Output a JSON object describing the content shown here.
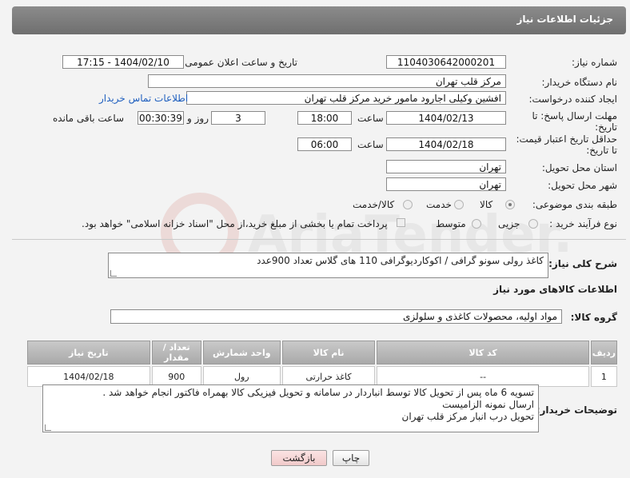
{
  "header": {
    "title": "جزئیات اطلاعات نیاز"
  },
  "fields": {
    "need_number_label": "شماره نیاز:",
    "need_number": "1104030642000201",
    "announce_label": "تاریخ و ساعت اعلان عمومی:",
    "announce_value": "1404/02/10 - 17:15",
    "buyer_org_label": "نام دستگاه خریدار:",
    "buyer_org": "مرکز قلب تهران",
    "creator_label": "ایجاد کننده درخواست:",
    "creator": "افشین وکیلی اجارود مامور خرید مرکز قلب تهران",
    "contact_link": "اطلاعات تماس خریدار",
    "deadline_label": "مهلت ارسال پاسخ: تا تاریخ:",
    "deadline_date": "1404/02/13",
    "time_label": "ساعت",
    "deadline_time": "18:00",
    "days": "3",
    "days_label": "روز و",
    "remaining": "00:30:39",
    "remaining_label": "ساعت باقی مانده",
    "validity_label": "حداقل تاریخ اعتبار قیمت: تا تاریخ:",
    "validity_date": "1404/02/18",
    "validity_time": "06:00",
    "province_label": "استان محل تحویل:",
    "province": "تهران",
    "city_label": "شهر محل تحویل:",
    "city": "تهران",
    "category_label": "طبقه بندی موضوعی:",
    "category_options": [
      "کالا",
      "خدمت",
      "کالا/خدمت"
    ],
    "process_label": "نوع فرآیند خرید :",
    "process_options": [
      "جزیی",
      "متوسط"
    ],
    "payment_note": "پرداخت تمام یا بخشی از مبلغ خرید،از محل \"اسناد خزانه اسلامی\" خواهد بود."
  },
  "description": {
    "label": "شرح کلی نیاز:",
    "text": "کاغذ رولی سونو گرافی / اکوکاردیوگرافی  110 های گلاس تعداد 900عدد"
  },
  "goods": {
    "section_title": "اطلاعات کالاهای مورد نیاز",
    "group_label": "گروه کالا:",
    "group_value": "مواد اولیه، محصولات کاغذی و سلولزی",
    "columns": [
      "ردیف",
      "کد کالا",
      "نام کالا",
      "واحد شمارش",
      "تعداد / مقدار",
      "تاریخ نیاز"
    ],
    "rows": [
      {
        "row": "1",
        "code": "--",
        "name": "کاغذ حرارتی",
        "unit": "رول",
        "qty": "900",
        "date": "1404/02/18"
      }
    ]
  },
  "buyer_notes": {
    "label": "توضیحات خریدار:",
    "lines": [
      "تسویه 6 ماه پس از تحویل کالا توسط انباردار در سامانه و تحویل فیزیکی کالا بهمراه فاکتور انجام خواهد شد .",
      "ارسال نمونه الزامیست",
      "تحویل درب انبار مرکز قلب تهران"
    ]
  },
  "buttons": {
    "print": "چاپ",
    "back": "بازگشت"
  },
  "watermark": {
    "text": "AriaTender.net"
  }
}
